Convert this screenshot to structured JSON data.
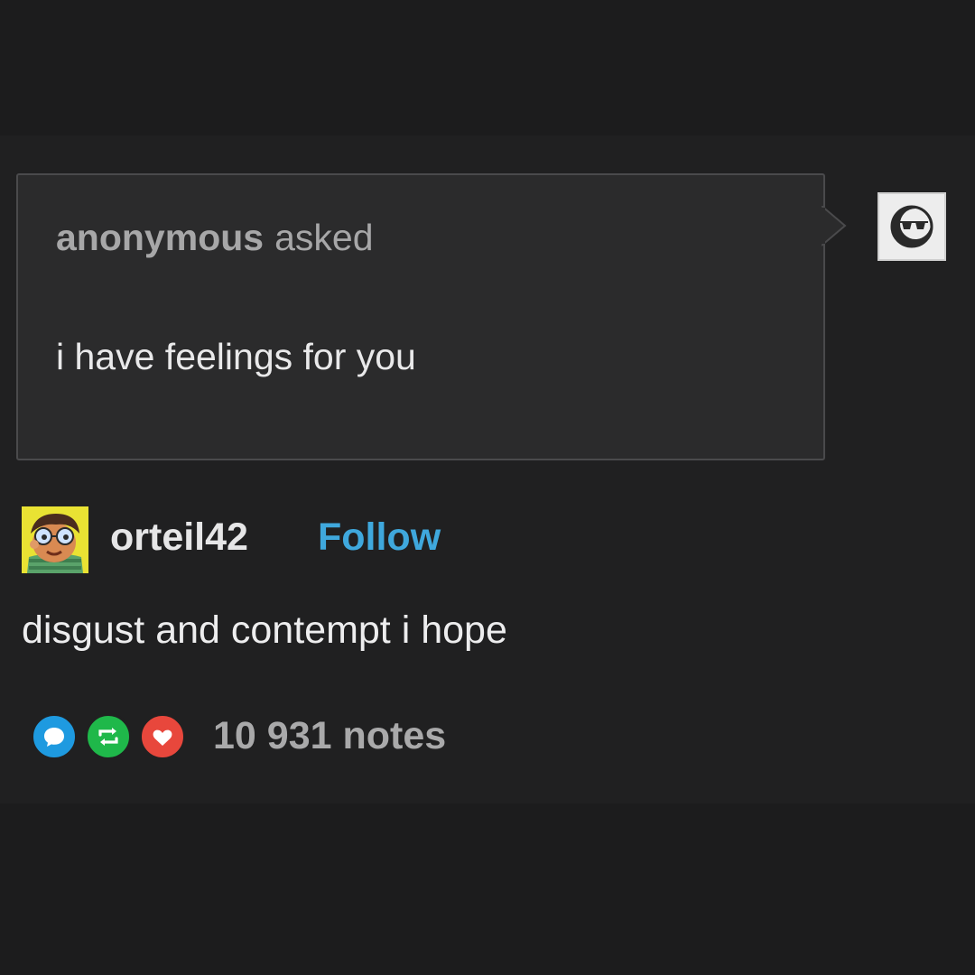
{
  "ask": {
    "asker": "anonymous",
    "verb": "asked",
    "question": "i have feelings for you"
  },
  "answer": {
    "username": "orteil42",
    "follow_label": "Follow",
    "text": "disgust and contempt i hope"
  },
  "notes": {
    "count_label": "10 931 notes",
    "icons": [
      "reply-icon",
      "reblog-icon",
      "like-icon"
    ]
  },
  "colors": {
    "background": "#1a1a1b",
    "post_background": "#202021",
    "ask_box": "#2b2b2c",
    "follow_blue": "#3fa8dd",
    "reply_blue": "#1e9ae0",
    "reblog_green": "#1fb84a",
    "like_red": "#e8473c"
  }
}
